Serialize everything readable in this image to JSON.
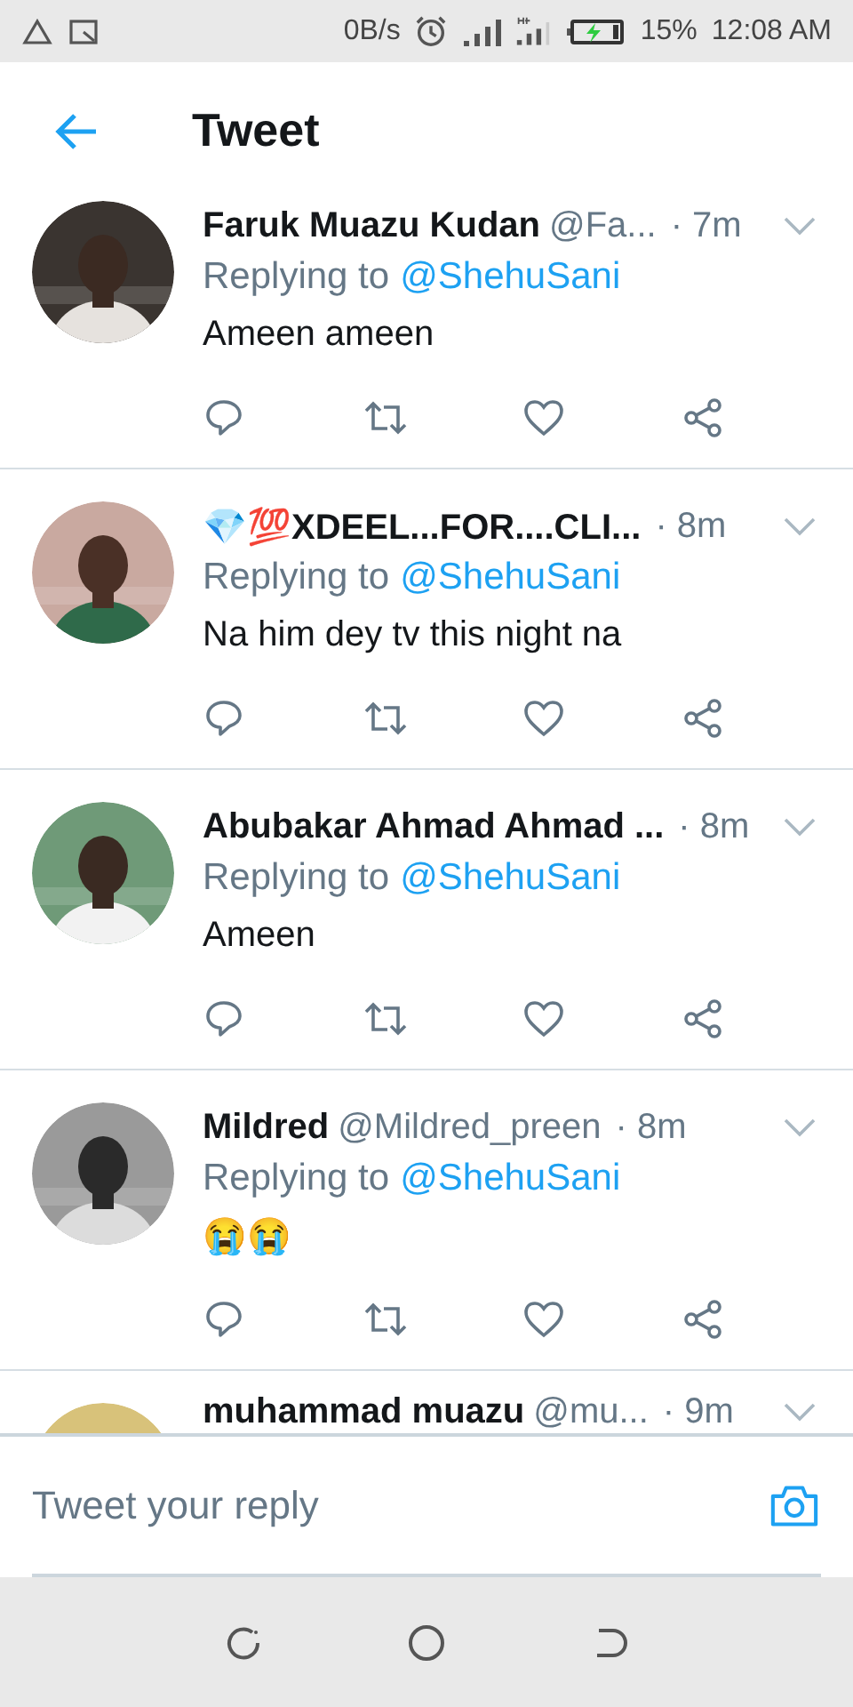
{
  "status_bar": {
    "net_speed": "0B/s",
    "battery": "15%",
    "time": "12:08 AM"
  },
  "header": {
    "title": "Tweet"
  },
  "tweets": [
    {
      "name": "Faruk Muazu Kudan",
      "handle": "@Fa...",
      "time": "· 7m",
      "replying_label": "Replying to",
      "mention": "@ShehuSani",
      "text": "Ameen ameen"
    },
    {
      "name": "💎💯XDEEL...FOR....CLI...",
      "time": "· 8m",
      "replying_label": "Replying to",
      "mention": "@ShehuSani",
      "text": "Na him dey tv this night na"
    },
    {
      "name": "Abubakar Ahmad Ahmad ...",
      "time": "· 8m",
      "replying_label": "Replying to",
      "mention": "@ShehuSani",
      "text": "Ameen"
    },
    {
      "name": "Mildred",
      "handle": "@Mildred_preen",
      "time": "· 8m",
      "replying_label": "Replying to",
      "mention": "@ShehuSani",
      "text": "😭😭"
    },
    {
      "name": "muhammad muazu",
      "handle": "@mu...",
      "time": "· 9m"
    }
  ],
  "reply_box": {
    "placeholder": "Tweet your reply"
  }
}
